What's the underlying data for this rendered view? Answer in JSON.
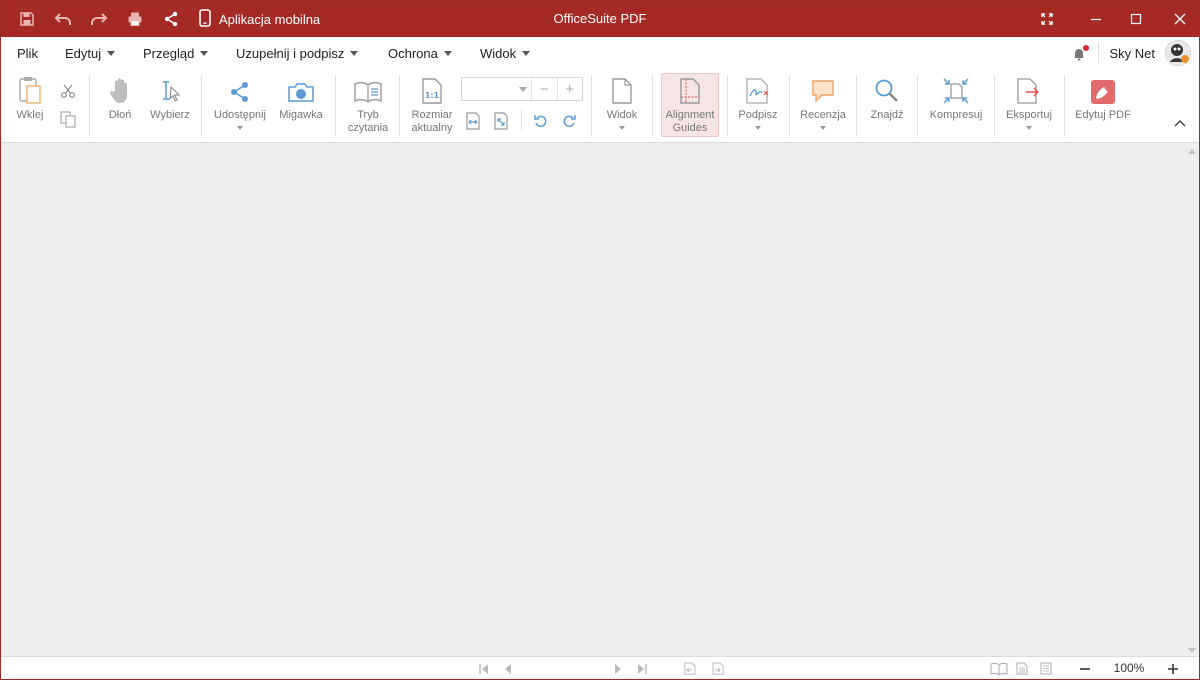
{
  "titlebar": {
    "app_title": "OfficeSuite PDF",
    "mobile_label": "Aplikacja mobilna",
    "icons": [
      "save-icon",
      "undo-icon",
      "redo-icon",
      "print-icon",
      "share-icon",
      "phone-icon",
      "fullscreen-icon",
      "minimize-icon",
      "maximize-icon",
      "close-icon"
    ]
  },
  "menu": {
    "items": [
      {
        "label": "Plik"
      },
      {
        "label": "Edytuj"
      },
      {
        "label": "Przegląd"
      },
      {
        "label": "Uzupełnij i podpisz"
      },
      {
        "label": "Ochrona"
      },
      {
        "label": "Widok"
      }
    ],
    "user_name": "Sky Net"
  },
  "ribbon": {
    "paste": "Wklej",
    "hand": "Dłoń",
    "select": "Wybierz",
    "share": "Udostępnij",
    "snapshot": "Migawka",
    "reading_mode_1": "Tryb",
    "reading_mode_2": "czytania",
    "actual_size_1": "Rozmiar",
    "actual_size_2": "aktualny",
    "zoom_value": "",
    "view": "Widok",
    "alignment_1": "Alignment",
    "alignment_2": "Guides",
    "sign": "Podpisz",
    "review": "Recenzja",
    "find": "Znajdź",
    "compress": "Kompresuj",
    "export": "Eksportuj",
    "edit_pdf": "Edytuj PDF"
  },
  "status": {
    "zoom": "100%"
  },
  "colors": {
    "brand": "#a52a26",
    "icon_blue": "#5b9bd5",
    "icon_gray": "#8c8c8c",
    "accent_orange": "#f0a060",
    "active_bg": "#f5e5e4"
  }
}
